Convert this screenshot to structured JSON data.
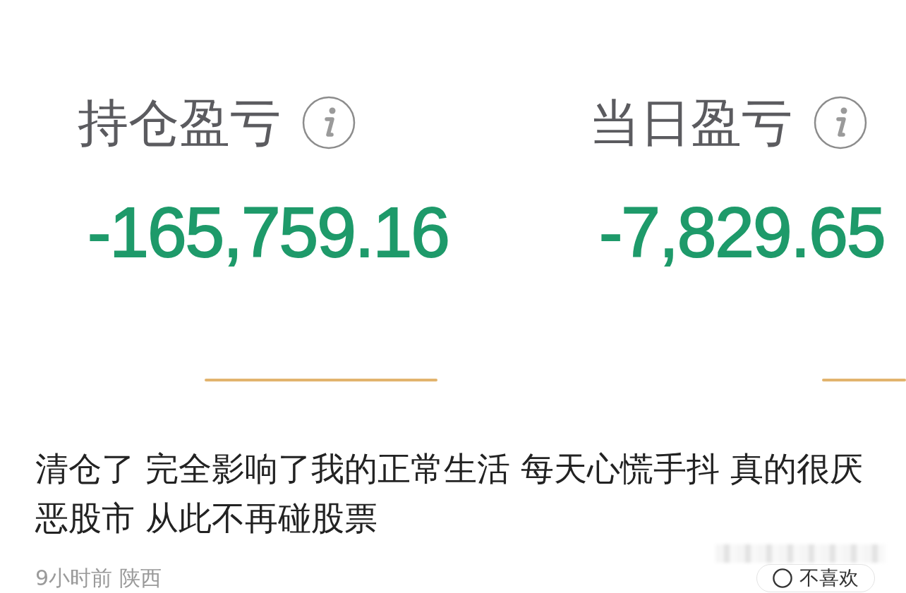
{
  "screenshot": {
    "metrics": [
      {
        "label": "持仓盈亏",
        "value": "-165,759.16"
      },
      {
        "label": "当日盈亏",
        "value": "-7,829.65"
      }
    ]
  },
  "post": {
    "text": "清仓了 完全影响了我的正常生活 每天心慌手抖 真的很厌恶股市 从此不再碰股票",
    "meta": "9小时前 陕西",
    "dislike_button": "不喜欢"
  }
}
